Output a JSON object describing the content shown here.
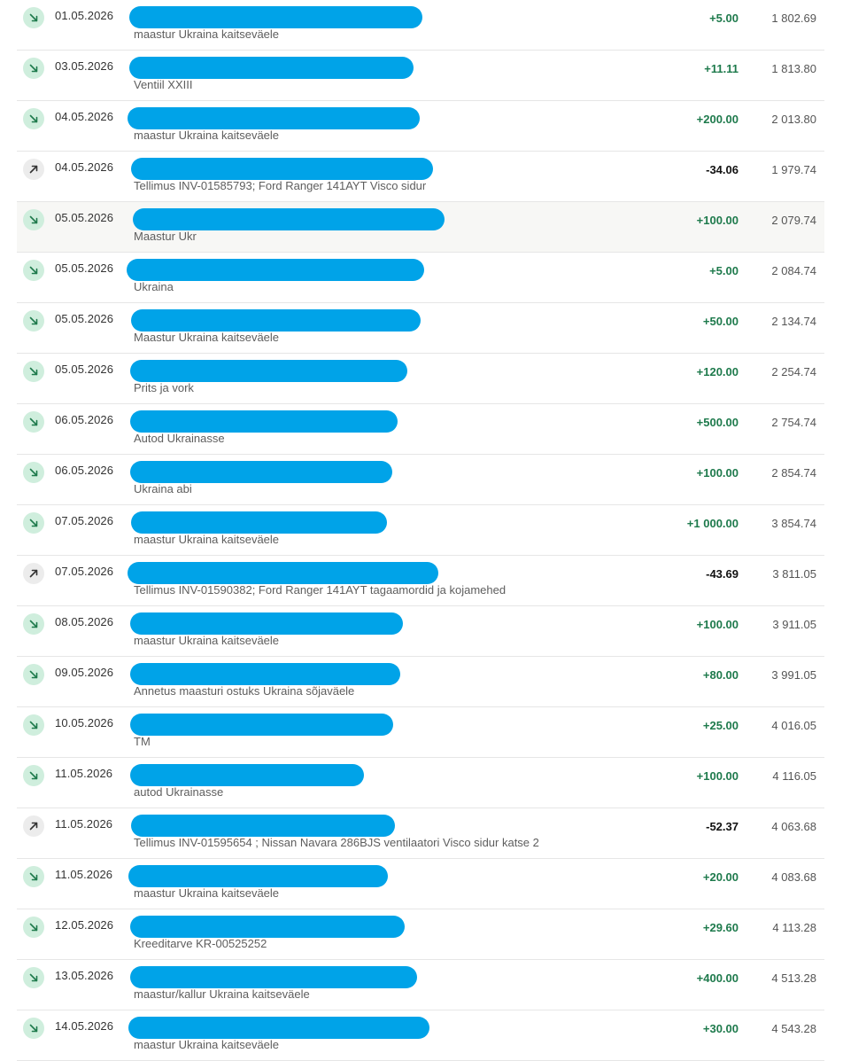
{
  "colors": {
    "incoming_amount": "#1e7a4c",
    "outgoing_amount": "#111111",
    "incoming_icon_bg": "#cfeedd",
    "outgoing_icon_bg": "#ececec",
    "redaction": "#00a3e8"
  },
  "icons": {
    "incoming": "arrow-down-right-icon",
    "outgoing": "arrow-up-right-icon"
  },
  "transactions": [
    {
      "date": "01.05.2026",
      "description": "maastur Ukraina kaitseväele",
      "amount": "+5.00",
      "balance": "1 802.69",
      "direction": "in"
    },
    {
      "date": "03.05.2026",
      "description": "Ventiil XXIII",
      "amount": "+11.11",
      "balance": "1 813.80",
      "direction": "in"
    },
    {
      "date": "04.05.2026",
      "description": "maastur Ukraina kaitseväele",
      "amount": "+200.00",
      "balance": "2 013.80",
      "direction": "in"
    },
    {
      "date": "04.05.2026",
      "description": "Tellimus INV-01585793; Ford Ranger 141AYT Visco sidur",
      "amount": "-34.06",
      "balance": "1 979.74",
      "direction": "out"
    },
    {
      "date": "05.05.2026",
      "description": "Maastur Ukr",
      "amount": "+100.00",
      "balance": "2 079.74",
      "direction": "in"
    },
    {
      "date": "05.05.2026",
      "description": "Ukraina",
      "amount": "+5.00",
      "balance": "2 084.74",
      "direction": "in"
    },
    {
      "date": "05.05.2026",
      "description": "Maastur Ukraina kaitseväele",
      "amount": "+50.00",
      "balance": "2 134.74",
      "direction": "in"
    },
    {
      "date": "05.05.2026",
      "description": "Prits ja vork",
      "amount": "+120.00",
      "balance": "2 254.74",
      "direction": "in"
    },
    {
      "date": "06.05.2026",
      "description": "Autod Ukrainasse",
      "amount": "+500.00",
      "balance": "2 754.74",
      "direction": "in"
    },
    {
      "date": "06.05.2026",
      "description": "Ukraina abi",
      "amount": "+100.00",
      "balance": "2 854.74",
      "direction": "in"
    },
    {
      "date": "07.05.2026",
      "description": "maastur Ukraina kaitseväele",
      "amount": "+1 000.00",
      "balance": "3 854.74",
      "direction": "in"
    },
    {
      "date": "07.05.2026",
      "description": "Tellimus INV-01590382; Ford Ranger 141AYT tagaamordid ja kojamehed",
      "amount": "-43.69",
      "balance": "3 811.05",
      "direction": "out"
    },
    {
      "date": "08.05.2026",
      "description": "maastur Ukraina kaitseväele",
      "amount": "+100.00",
      "balance": "3 911.05",
      "direction": "in"
    },
    {
      "date": "09.05.2026",
      "description": "Annetus maasturi ostuks Ukraina sõjaväele",
      "amount": "+80.00",
      "balance": "3 991.05",
      "direction": "in"
    },
    {
      "date": "10.05.2026",
      "description": "TM",
      "amount": "+25.00",
      "balance": "4 016.05",
      "direction": "in"
    },
    {
      "date": "11.05.2026",
      "description": "autod Ukrainasse",
      "amount": "+100.00",
      "balance": "4 116.05",
      "direction": "in"
    },
    {
      "date": "11.05.2026",
      "description": "Tellimus INV-01595654 ; Nissan Navara 286BJS ventilaatori Visco sidur katse 2",
      "amount": "-52.37",
      "balance": "4 063.68",
      "direction": "out"
    },
    {
      "date": "11.05.2026",
      "description": "maastur Ukraina kaitseväele",
      "amount": "+20.00",
      "balance": "4 083.68",
      "direction": "in"
    },
    {
      "date": "12.05.2026",
      "description": "Kreeditarve KR-00525252",
      "amount": "+29.60",
      "balance": "4 113.28",
      "direction": "in"
    },
    {
      "date": "13.05.2026",
      "description": "maastur/kallur Ukraina kaitseväele",
      "amount": "+400.00",
      "balance": "4 513.28",
      "direction": "in"
    },
    {
      "date": "14.05.2026",
      "description": "maastur Ukraina kaitseväele",
      "amount": "+30.00",
      "balance": "4 543.28",
      "direction": "in"
    }
  ]
}
